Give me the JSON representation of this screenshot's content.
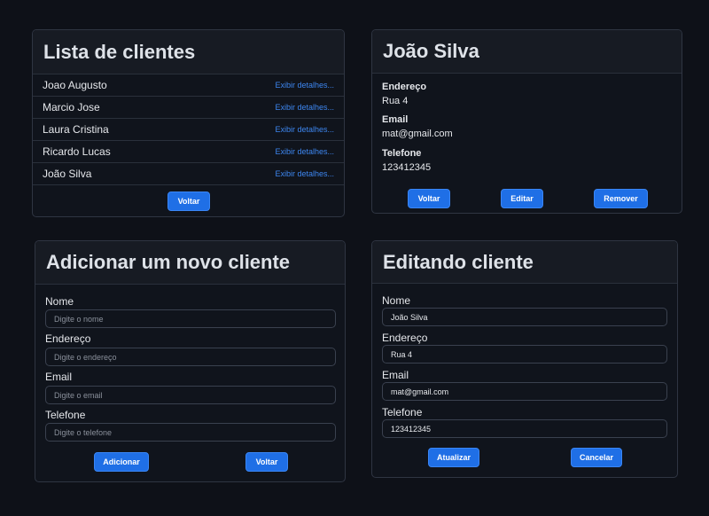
{
  "client_list": {
    "title": "Lista de clientes",
    "clients": [
      {
        "name": "Joao Augusto",
        "link": "Exibir detalhes..."
      },
      {
        "name": "Marcio Jose",
        "link": "Exibir detalhes..."
      },
      {
        "name": "Laura Cristina",
        "link": "Exibir detalhes..."
      },
      {
        "name": "Ricardo Lucas",
        "link": "Exibir detalhes..."
      },
      {
        "name": "João Silva",
        "link": "Exibir detalhes..."
      }
    ],
    "back_label": "Voltar"
  },
  "client_detail": {
    "title": "João Silva",
    "address_label": "Endereço",
    "address_value": "Rua 4",
    "email_label": "Email",
    "email_value": "mat@gmail.com",
    "phone_label": "Telefone",
    "phone_value": "123412345",
    "back_label": "Voltar",
    "edit_label": "Editar",
    "remove_label": "Remover"
  },
  "add_client": {
    "title": "Adicionar um novo cliente",
    "name_label": "Nome",
    "name_placeholder": "Digite o nome",
    "address_label": "Endereço",
    "address_placeholder": "Digite o endereço",
    "email_label": "Email",
    "email_placeholder": "Digite o email",
    "phone_label": "Telefone",
    "phone_placeholder": "Digite o telefone",
    "add_label": "Adicionar",
    "back_label": "Voltar"
  },
  "edit_client": {
    "title": "Editando cliente",
    "name_label": "Nome",
    "name_value": "João Silva",
    "address_label": "Endereço",
    "address_value": "Rua 4",
    "email_label": "Email",
    "email_value": "mat@gmail.com",
    "phone_label": "Telefone",
    "phone_value": "123412345",
    "update_label": "Atualizar",
    "cancel_label": "Cancelar"
  },
  "colors": {
    "background": "#0e1118",
    "primary": "#1f6fe6",
    "link": "#3d86f0"
  }
}
